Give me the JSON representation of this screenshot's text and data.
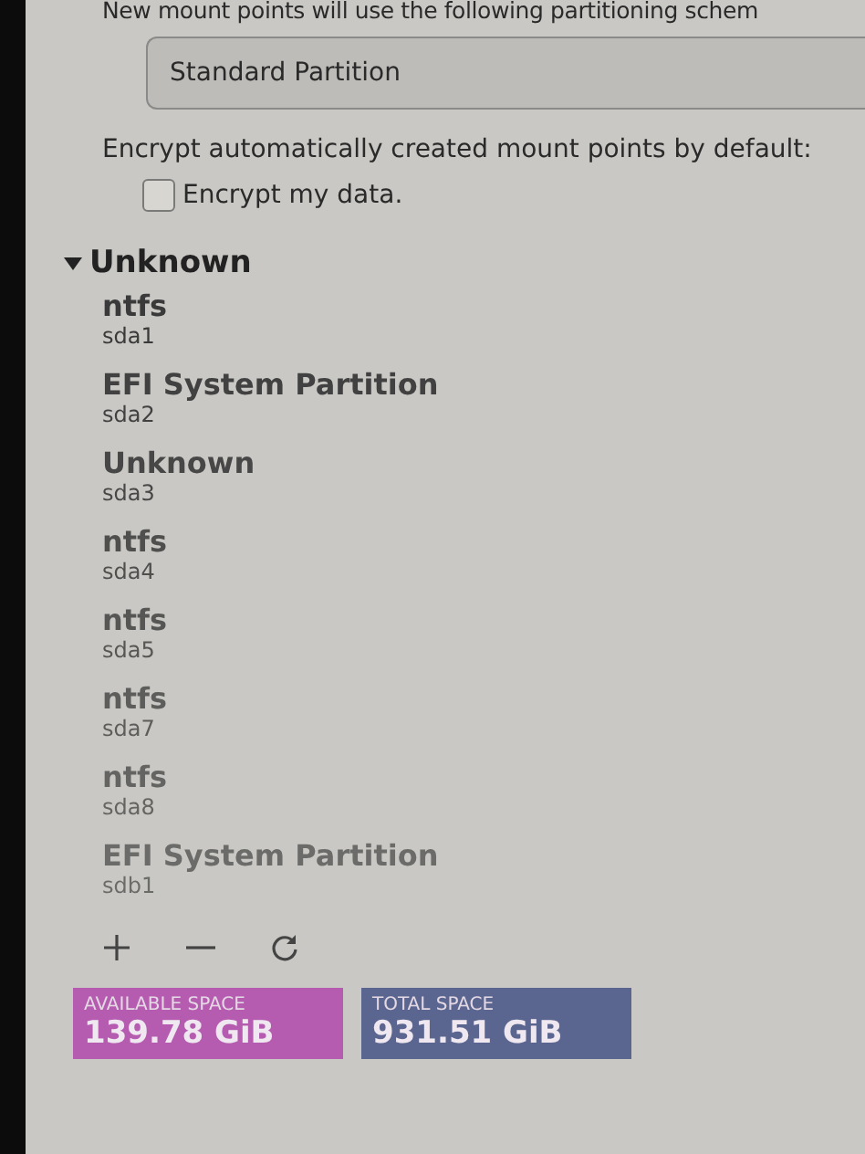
{
  "scheme_label": "New mount points will use the following partitioning schem",
  "scheme_dropdown": {
    "value": "Standard Partition"
  },
  "encrypt_label": "Encrypt automatically created mount points by default:",
  "encrypt_checkbox": {
    "label": "Encrypt my data.",
    "checked": false
  },
  "group": {
    "title": "Unknown",
    "expanded": true,
    "items": [
      {
        "name": "ntfs",
        "device": "sda1"
      },
      {
        "name": "EFI System Partition",
        "device": "sda2"
      },
      {
        "name": "Unknown",
        "device": "sda3"
      },
      {
        "name": "ntfs",
        "device": "sda4"
      },
      {
        "name": "ntfs",
        "device": "sda5"
      },
      {
        "name": "ntfs",
        "device": "sda7"
      },
      {
        "name": "ntfs",
        "device": "sda8"
      },
      {
        "name": "EFI System Partition",
        "device": "sdb1"
      }
    ]
  },
  "space": [
    {
      "label": "AVAILABLE SPACE",
      "value": "139.78 GiB",
      "color": "#b55cb0"
    },
    {
      "label": "TOTAL SPACE",
      "value": "931.51 GiB",
      "color": "#5a6690"
    }
  ]
}
